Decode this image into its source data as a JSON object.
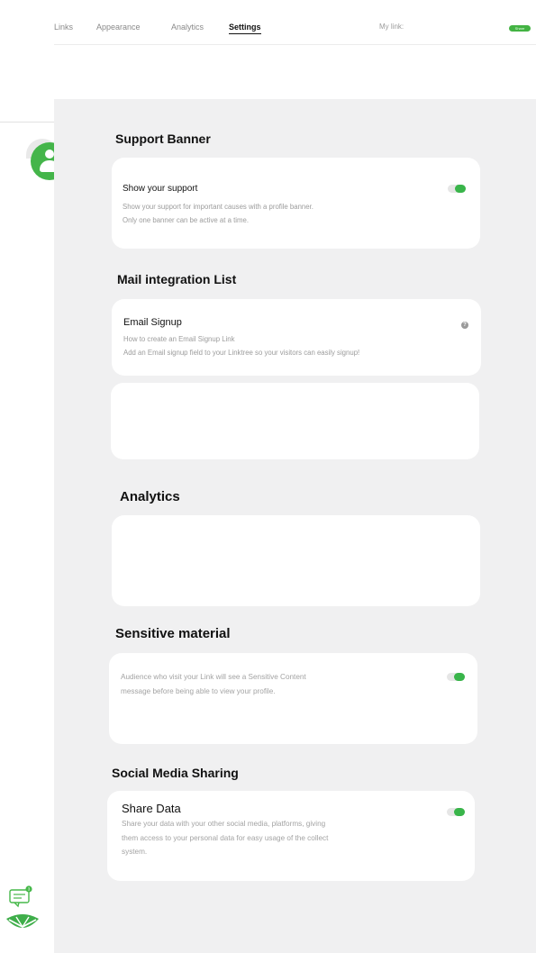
{
  "nav": {
    "tabs": [
      {
        "label": "Links"
      },
      {
        "label": "Appearance"
      },
      {
        "label": "Analytics"
      },
      {
        "label": "Settings"
      }
    ],
    "my_link_label": "My link:",
    "share_label": "Share"
  },
  "sidebar": {
    "avatar_icon": "user-avatar-icon",
    "chat_icon": "chat-icon",
    "chat_badge": "3",
    "logo_icon": "leaf-logo-icon"
  },
  "sections": {
    "support_banner": {
      "title": "Support Banner",
      "card_title": "Show your support",
      "desc_line1": "Show your support for important causes with a profile banner.",
      "desc_line2": "Only one banner can be active at a time.",
      "toggle_on": true
    },
    "mail_integration": {
      "title": "Mail integration List",
      "card_title": "Email Signup",
      "desc_line1": "How to create an Email Signup Link",
      "desc_line2": "Add an Email signup field to your Linktree so your visitors can easily signup!",
      "help_icon": "?"
    },
    "analytics": {
      "title": "Analytics"
    },
    "sensitive": {
      "title": "Sensitive material",
      "desc_line1": "Audience who visit your Link will see a Sensitive Content",
      "desc_line2": "message before being able to view your profile.",
      "toggle_on": true
    },
    "social": {
      "title": "Social Media Sharing",
      "card_title": "Share Data",
      "desc_line1": "Share your data with your other social media, platforms, giving",
      "desc_line2": "them access to your personal data for easy usage of the collect",
      "desc_line3": "system.",
      "toggle_on": true
    }
  },
  "colors": {
    "accent_green": "#39b54a",
    "panel_bg": "#f0f0f1",
    "card_bg": "#ffffff"
  }
}
